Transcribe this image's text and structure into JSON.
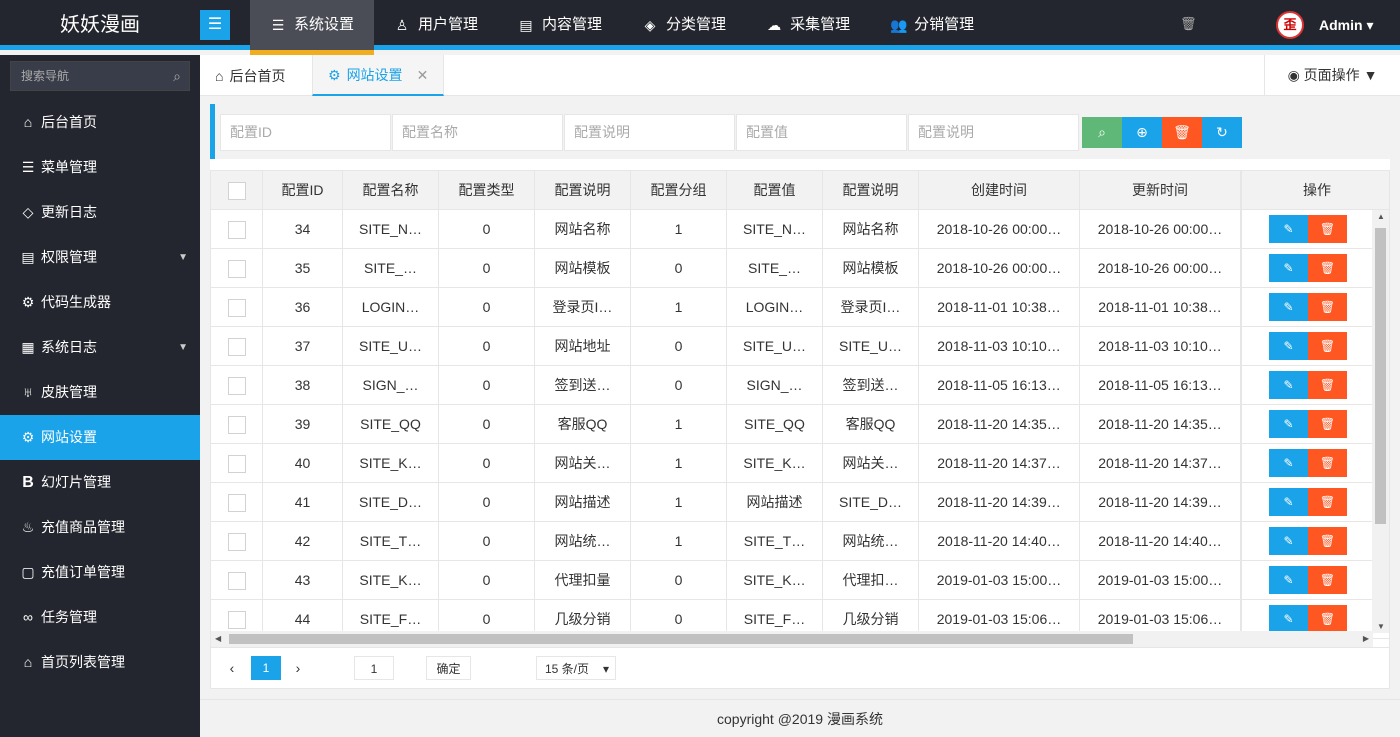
{
  "header": {
    "logo": "妖妖漫画",
    "nav": [
      {
        "label": "系统设置",
        "icon": "menu-icon"
      },
      {
        "label": "用户管理",
        "icon": "user-icon"
      },
      {
        "label": "内容管理",
        "icon": "document-icon"
      },
      {
        "label": "分类管理",
        "icon": "layers-icon"
      },
      {
        "label": "采集管理",
        "icon": "cloud-upload-icon"
      },
      {
        "label": "分销管理",
        "icon": "users-icon"
      }
    ],
    "user": "Admin"
  },
  "sidebar": {
    "search_placeholder": "搜索导航",
    "items": [
      {
        "label": "后台首页"
      },
      {
        "label": "菜单管理"
      },
      {
        "label": "更新日志"
      },
      {
        "label": "权限管理"
      },
      {
        "label": "代码生成器"
      },
      {
        "label": "系统日志"
      },
      {
        "label": "皮肤管理"
      },
      {
        "label": "网站设置"
      },
      {
        "label": "幻灯片管理"
      },
      {
        "label": "充值商品管理"
      },
      {
        "label": "充值订单管理"
      },
      {
        "label": "任务管理"
      },
      {
        "label": "首页列表管理"
      }
    ]
  },
  "tabs": {
    "home": "后台首页",
    "current": "网站设置",
    "page_ops": "页面操作"
  },
  "filters": {
    "p1": "配置ID",
    "p2": "配置名称",
    "p3": "配置说明",
    "p4": "配置值",
    "p5": "配置说明"
  },
  "table": {
    "headers": [
      "配置ID",
      "配置名称",
      "配置类型",
      "配置说明",
      "配置分组",
      "配置值",
      "配置说明",
      "创建时间",
      "更新时间",
      "操作"
    ],
    "rows": [
      [
        "34",
        "SITE_N…",
        "0",
        "网站名称",
        "1",
        "SITE_N…",
        "网站名称",
        "2018-10-26 00:00…",
        "2018-10-26 00:00…"
      ],
      [
        "35",
        "SITE_…",
        "0",
        "网站模板",
        "0",
        "SITE_…",
        "网站模板",
        "2018-10-26 00:00…",
        "2018-10-26 00:00…"
      ],
      [
        "36",
        "LOGIN…",
        "0",
        "登录页I…",
        "1",
        "LOGIN…",
        "登录页I…",
        "2018-11-01 10:38…",
        "2018-11-01 10:38…"
      ],
      [
        "37",
        "SITE_U…",
        "0",
        "网站地址",
        "0",
        "SITE_U…",
        "SITE_U…",
        "2018-11-03 10:10…",
        "2018-11-03 10:10…"
      ],
      [
        "38",
        "SIGN_…",
        "0",
        "签到送…",
        "0",
        "SIGN_…",
        "签到送…",
        "2018-11-05 16:13…",
        "2018-11-05 16:13…"
      ],
      [
        "39",
        "SITE_QQ",
        "0",
        "客服QQ",
        "1",
        "SITE_QQ",
        "客服QQ",
        "2018-11-20 14:35…",
        "2018-11-20 14:35…"
      ],
      [
        "40",
        "SITE_K…",
        "0",
        "网站关…",
        "1",
        "SITE_K…",
        "网站关…",
        "2018-11-20 14:37…",
        "2018-11-20 14:37…"
      ],
      [
        "41",
        "SITE_D…",
        "0",
        "网站描述",
        "1",
        "网站描述",
        "SITE_D…",
        "2018-11-20 14:39…",
        "2018-11-20 14:39…"
      ],
      [
        "42",
        "SITE_T…",
        "0",
        "网站统…",
        "1",
        "SITE_T…",
        "网站统…",
        "2018-11-20 14:40…",
        "2018-11-20 14:40…"
      ],
      [
        "43",
        "SITE_K…",
        "0",
        "代理扣量",
        "0",
        "SITE_K…",
        "代理扣…",
        "2019-01-03 15:00…",
        "2019-01-03 15:00…"
      ],
      [
        "44",
        "SITE_F…",
        "0",
        "几级分销",
        "0",
        "SITE_F…",
        "几级分销",
        "2019-01-03 15:06…",
        "2019-01-03 15:06…"
      ]
    ]
  },
  "pager": {
    "current_page": "1",
    "goto_value": "1",
    "confirm": "确定",
    "page_size": "15 条/页"
  },
  "footer": "copyright @2019 漫画系统"
}
